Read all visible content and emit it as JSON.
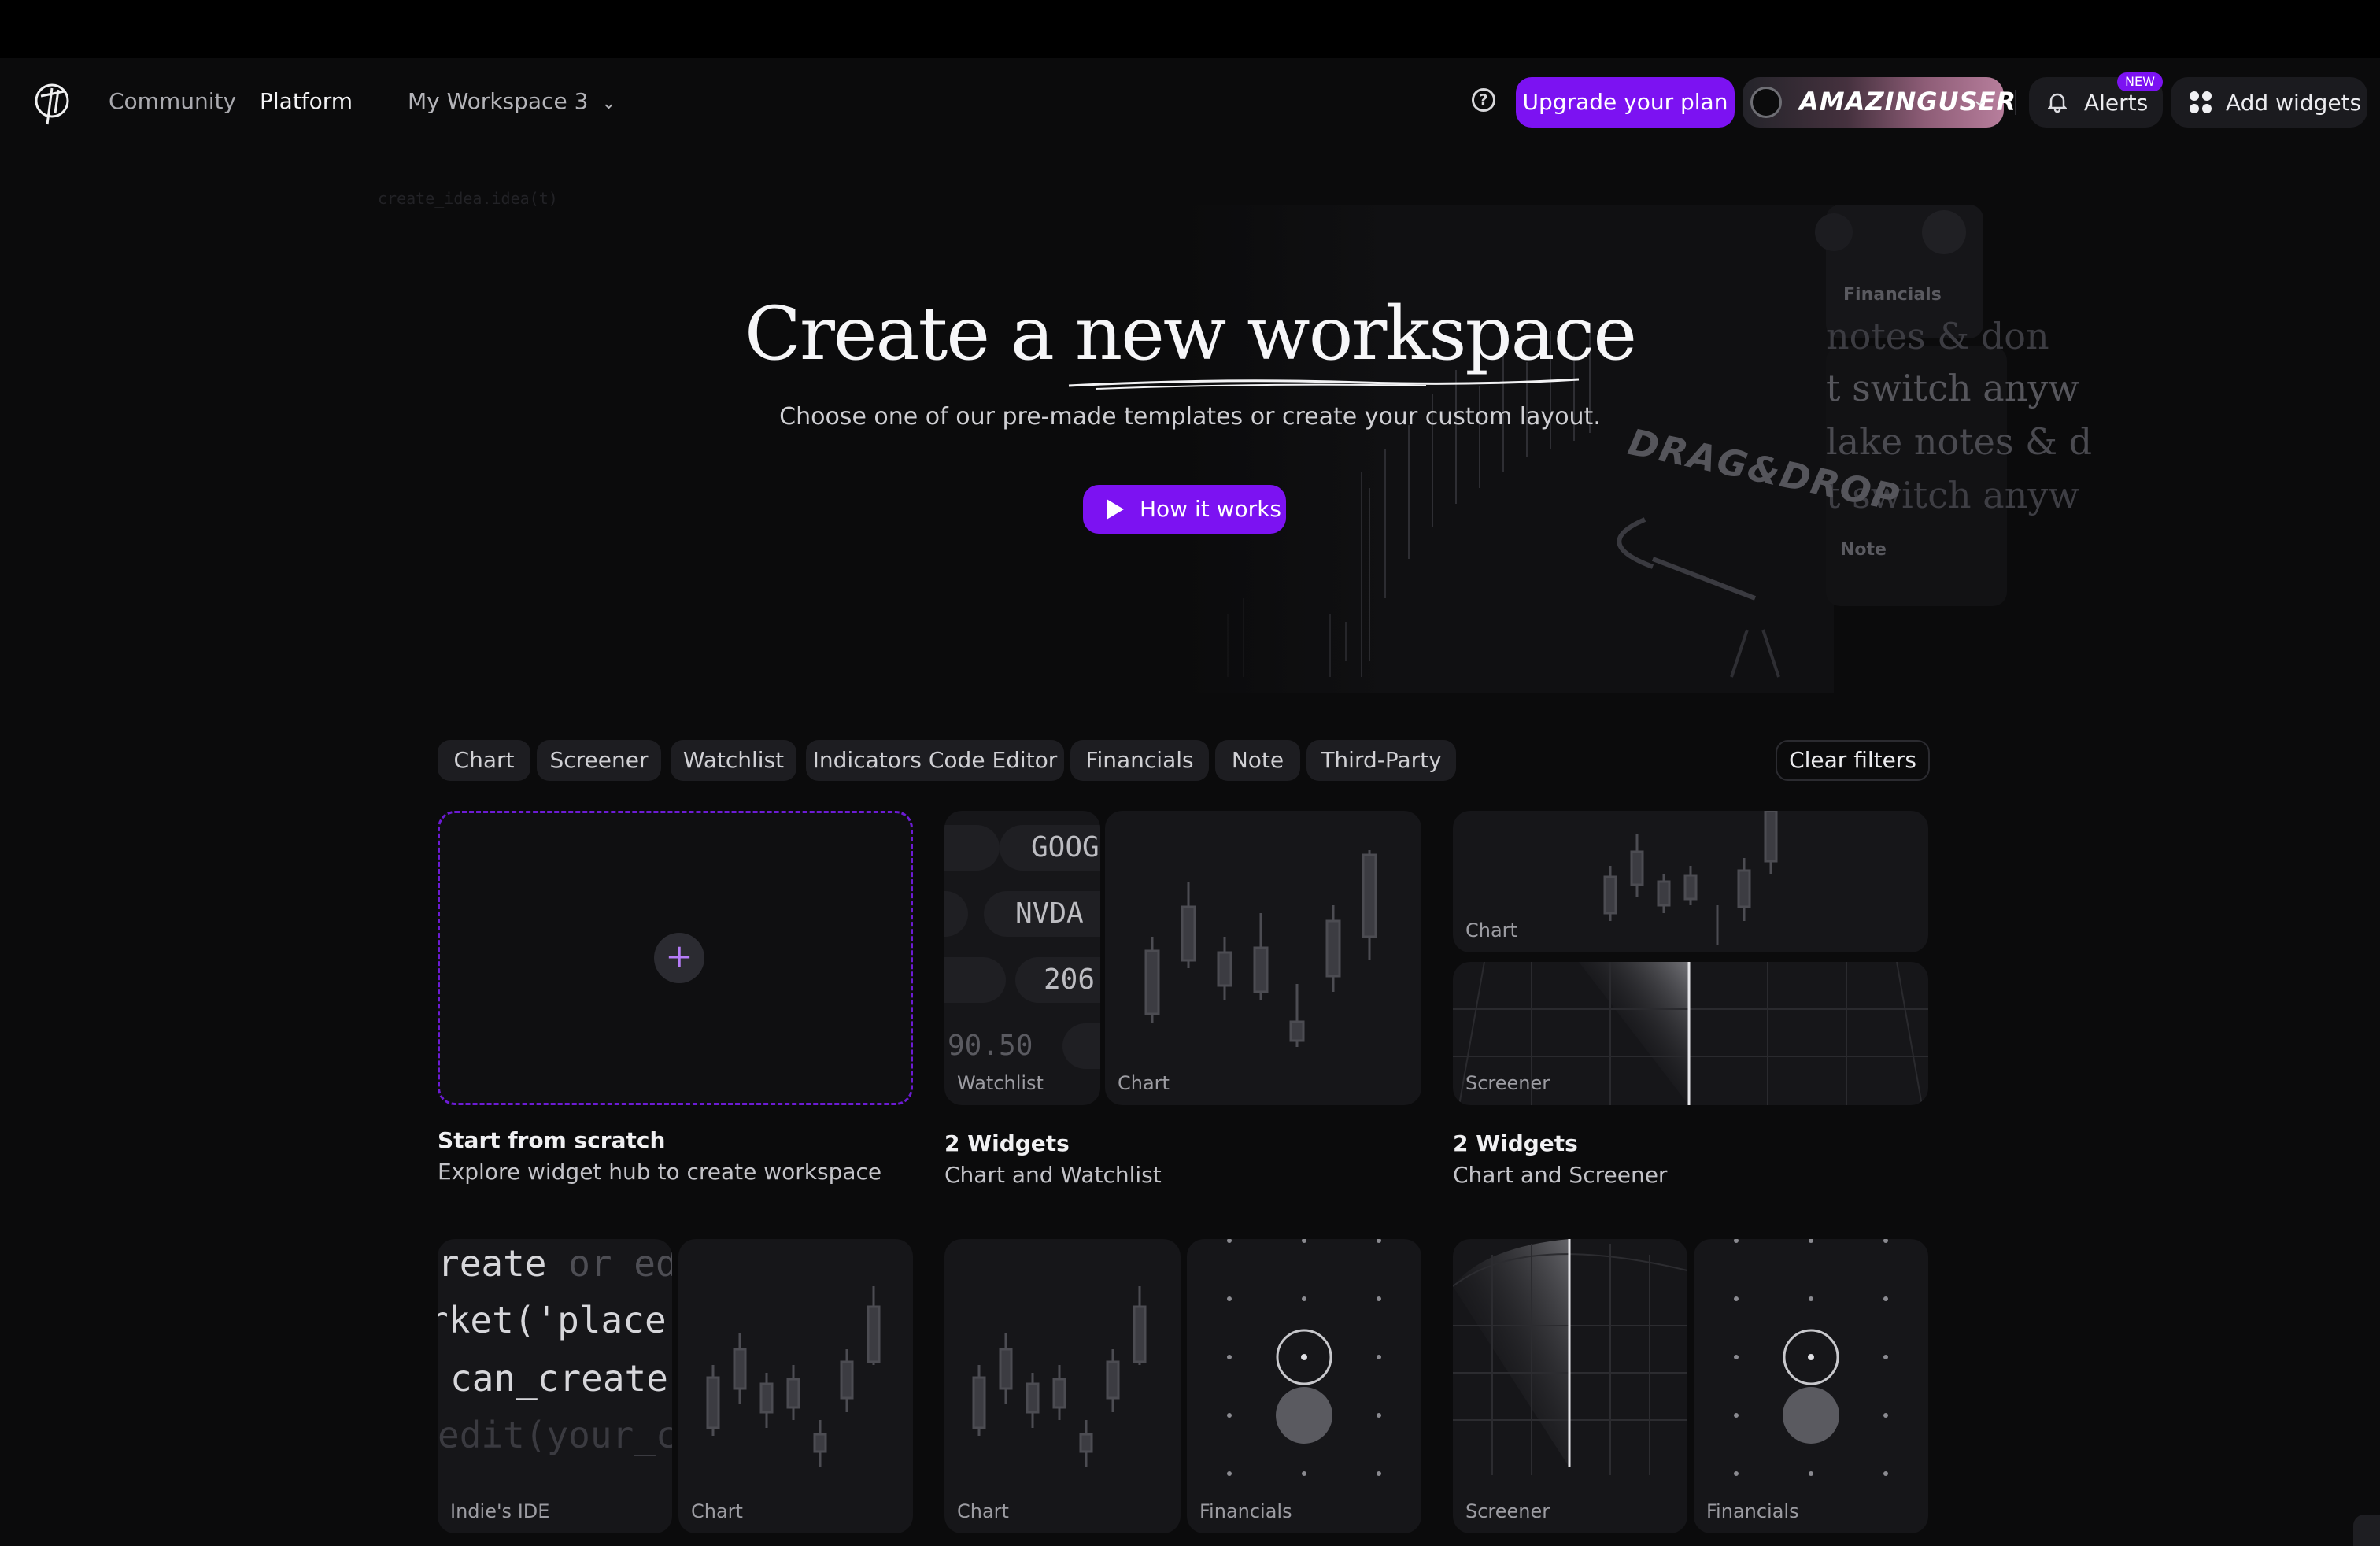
{
  "nav": {
    "community": "Community",
    "platform": "Platform",
    "workspace": "My Workspace 3",
    "workspace_chevron": "⌄",
    "help_glyph": "?",
    "upgrade": "Upgrade your plan",
    "username": "AMAZINGUSER",
    "user_chevron": "⌄",
    "alerts": "Alerts",
    "new_badge": "NEW",
    "add_widgets": "Add widgets",
    "icons": [
      "logo-icon",
      "help-icon",
      "avatar",
      "bell-icon",
      "widgets-grid-icon"
    ]
  },
  "hero": {
    "title": "Create a new workspace",
    "subtitle": "Choose one of our pre-made templates or create your custom layout.",
    "how_it_works": "How it works",
    "bg_financials": "Financials",
    "bg_note": "Note",
    "bg_text_1": "notes & don",
    "bg_text_2": "t switch anyw",
    "bg_text_3": "lake notes & d",
    "bg_text_4": "t switch anyw",
    "bg_drag": "DRAG&DROP",
    "bg_code": "create_idea.idea(t)"
  },
  "filters": {
    "chips": [
      "Chart",
      "Screener",
      "Watchlist",
      "Indicators Code Editor",
      "Financials",
      "Note",
      "Third-Party"
    ],
    "clear": "Clear filters"
  },
  "templates": {
    "scratch": {
      "plus": "+",
      "title": "Start from scratch",
      "desc": "Explore widget hub to create workspace"
    },
    "t1": {
      "tickers": [
        "GOOG",
        "NVDA",
        "206.",
        "90.50"
      ],
      "label_a": "Watchlist",
      "label_b": "Chart",
      "title": "2 Widgets",
      "desc": "Chart and Watchlist"
    },
    "t2": {
      "label_a": "Chart",
      "label_b": "Screener",
      "title": "2 Widgets",
      "desc": "Chart and Screener"
    },
    "t3": {
      "code": [
        "reate",
        "or ed",
        "rket('place",
        "can_create",
        "edit(your_c"
      ],
      "label_a": "Indie's IDE",
      "label_b": "Chart"
    },
    "t4": {
      "label_a": "Chart",
      "label_b": "Financials"
    },
    "t5": {
      "label_a": "Screener",
      "label_b": "Financials"
    }
  },
  "colors": {
    "accent": "#7c12f2",
    "background": "#0b0b0c",
    "card": "#161619"
  }
}
